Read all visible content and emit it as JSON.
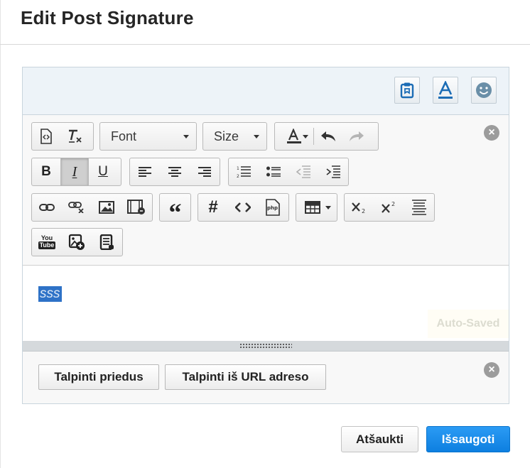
{
  "dialog": {
    "title": "Edit Post Signature"
  },
  "toolbar": {
    "font_label": "Font",
    "size_label": "Size"
  },
  "content": {
    "text": "sss",
    "auto_saved": "Auto-Saved"
  },
  "attachments": {
    "attach_label": "Talpinti priedus",
    "attach_url_label": "Talpinti iš URL adreso"
  },
  "footer": {
    "cancel_label": "Atšaukti",
    "save_label": "Išsaugoti"
  },
  "icons": {
    "youtube_top": "You",
    "youtube_bottom": "Tube",
    "php": "php"
  },
  "colors": {
    "primary": "#1587e8",
    "selection": "#2e72c7",
    "topbar_bg": "#edf3f8"
  }
}
